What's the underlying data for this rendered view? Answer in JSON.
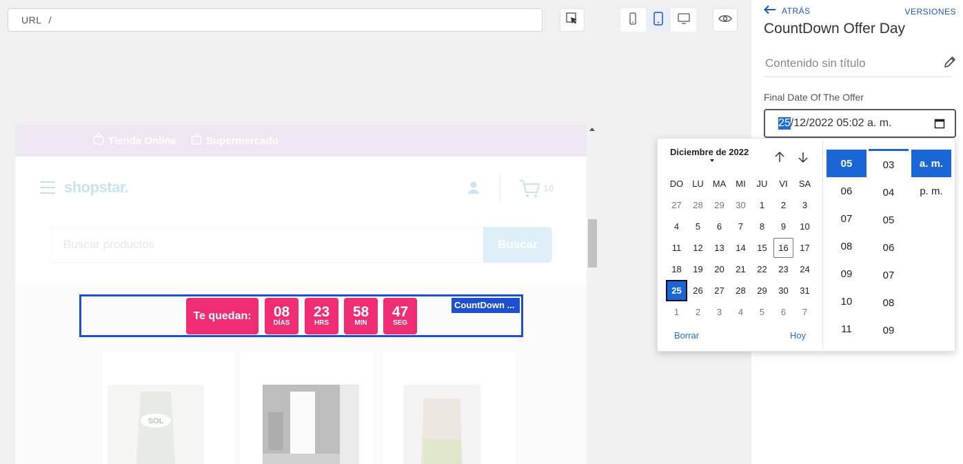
{
  "toolbar": {
    "url_label": "URL",
    "url_value": "/"
  },
  "site": {
    "topbar": [
      "Tienda Online",
      "Supermercado"
    ],
    "logo": "shopstar.",
    "cart_count": "10",
    "search_placeholder": "Buscar productos",
    "search_button": "Buscar"
  },
  "countdown": {
    "label": "Te quedan:",
    "tag": "CountDown ...",
    "units": [
      {
        "value": "08",
        "unit": "DÍAS"
      },
      {
        "value": "23",
        "unit": "HRS"
      },
      {
        "value": "58",
        "unit": "MIN"
      },
      {
        "value": "47",
        "unit": "SEG"
      }
    ]
  },
  "panel": {
    "back": "ATRÁS",
    "versions": "VERSIONES",
    "title": "CountDown Offer Day",
    "subtitle": "Contenido sin título",
    "field_label": "Final Date Of The Offer",
    "date_day": "25",
    "date_rest": "/12/2022 05:02 a. m."
  },
  "picker": {
    "month": "Diciembre de 2022",
    "weekdays": [
      "DO",
      "LU",
      "MA",
      "MI",
      "JU",
      "VI",
      "SA"
    ],
    "weeks": [
      [
        "27",
        "28",
        "29",
        "30",
        "1",
        "2",
        "3"
      ],
      [
        "4",
        "5",
        "6",
        "7",
        "8",
        "9",
        "10"
      ],
      [
        "11",
        "12",
        "13",
        "14",
        "15",
        "16",
        "17"
      ],
      [
        "18",
        "19",
        "20",
        "21",
        "22",
        "23",
        "24"
      ],
      [
        "25",
        "26",
        "27",
        "28",
        "29",
        "30",
        "31"
      ],
      [
        "1",
        "2",
        "3",
        "4",
        "5",
        "6",
        "7"
      ]
    ],
    "clear": "Borrar",
    "today": "Hoy",
    "hours": [
      "05",
      "06",
      "07",
      "08",
      "09",
      "10",
      "11"
    ],
    "minutes": [
      "03",
      "04",
      "05",
      "06",
      "07",
      "08",
      "09"
    ],
    "ampm": [
      "a. m.",
      "p. m."
    ]
  },
  "colors": {
    "accent": "#1e55c6",
    "countdown": "#ef2d72",
    "selection": "#1a66d6"
  }
}
